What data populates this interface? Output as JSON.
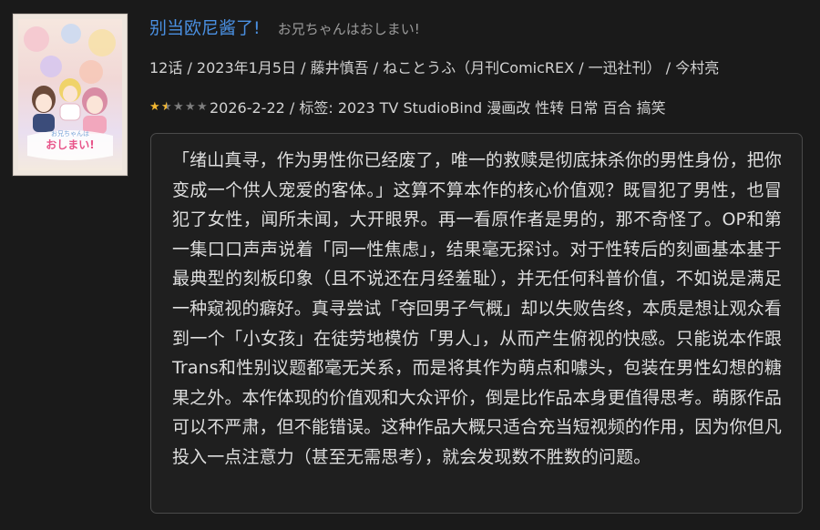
{
  "entry": {
    "title_cn": "别当欧尼酱了!",
    "title_jp": "お兄ちゃんはおしまい!",
    "meta": "12话 / 2023年1月5日 / 藤井慎吾 / ねことうふ（月刊ComicREX / 一迅社刊） / 今村亮",
    "rating": {
      "value": 1.5,
      "max": 5
    },
    "date_tags": "2026-2-22 / 标签: 2023 TV StudioBind 漫画改 性转 日常 百合 搞笑",
    "cover_text": "お兄ちゃんはおしまい!",
    "comment": "「绪山真寻，作为男性你已经废了，唯一的救赎是彻底抹杀你的男性身份，把你变成一个供人宠爱的客体。」这算不算本作的核心价值观？既冒犯了男性，也冒犯了女性，闻所未闻，大开眼界。再一看原作者是男的，那不奇怪了。OP和第一集口口声声说着「同一性焦虑」，结果毫无探讨。对于性转后的刻画基本基于最典型的刻板印象（且不说还在月经羞耻），并无任何科普价值，不如说是满足一种窥视的癖好。真寻尝试「夺回男子气概」却以失败告终，本质是想让观众看到一个「小女孩」在徒劳地模仿「男人」，从而产生俯视的快感。只能说本作跟Trans和性别议题都毫无关系，而是将其作为萌点和噱头，包装在男性幻想的糖果之外。本作体现的价值观和大众评价，倒是比作品本身更值得思考。萌豚作品可以不严肃，但不能错误。这种作品大概只适合充当短视频的作用，因为你但凡投入一点注意力（甚至无需思考），就会发现数不胜数的问题。"
  },
  "colors": {
    "background": "#1a1a1a",
    "title_link": "#4a90e2",
    "star_full": "#f1b631",
    "star_empty": "#7d7d7d",
    "comment_border": "#4a4a4a"
  },
  "icons": {
    "rating": "star-icon"
  }
}
